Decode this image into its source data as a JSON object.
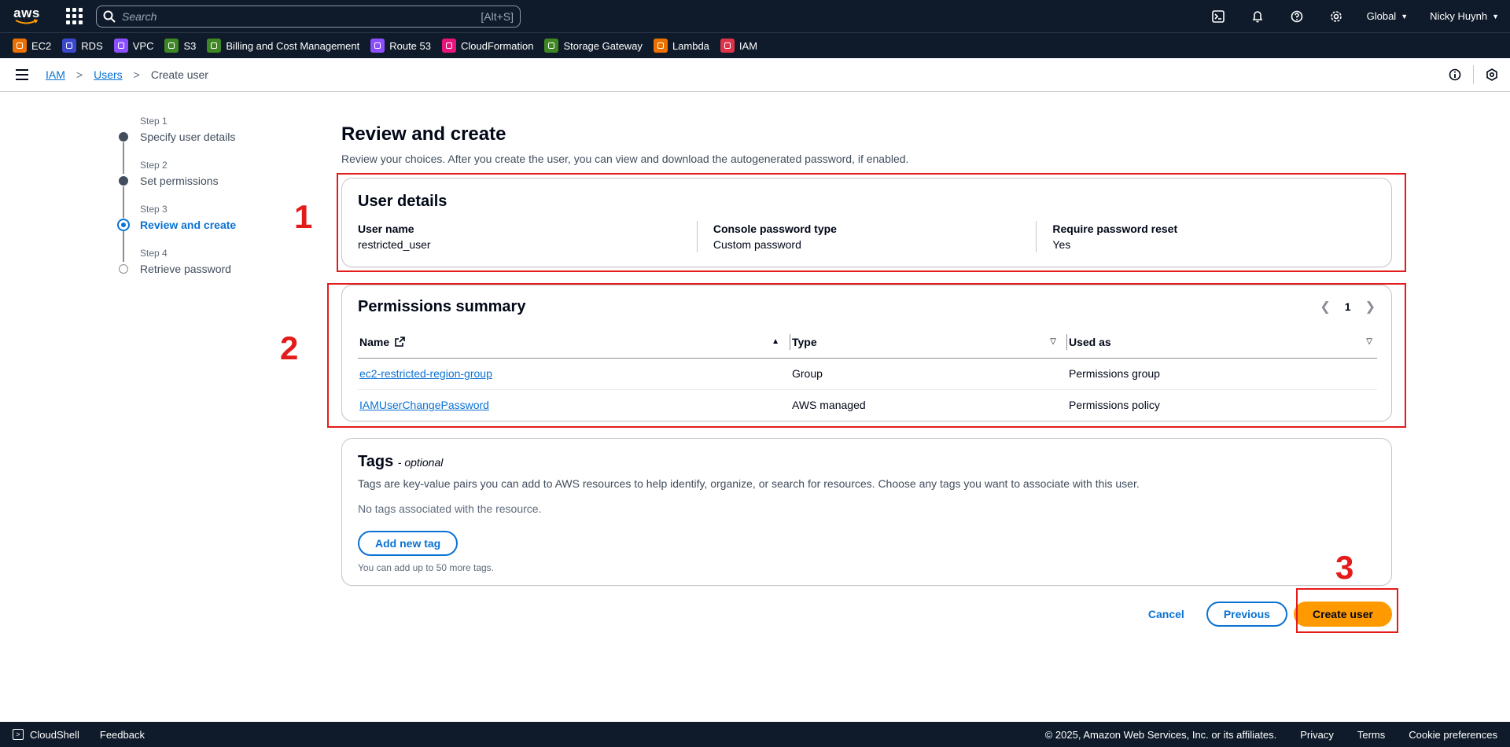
{
  "topbar": {
    "logo_text": "aws",
    "search_placeholder": "Search",
    "search_hint": "[Alt+S]",
    "region": "Global",
    "user": "Nicky Huynh"
  },
  "favorites": [
    {
      "label": "EC2",
      "color": "#ed7100"
    },
    {
      "label": "RDS",
      "color": "#3b48cc"
    },
    {
      "label": "VPC",
      "color": "#8c4fff"
    },
    {
      "label": "S3",
      "color": "#3f8624"
    },
    {
      "label": "Billing and Cost Management",
      "color": "#3f8624"
    },
    {
      "label": "Route 53",
      "color": "#8c4fff"
    },
    {
      "label": "CloudFormation",
      "color": "#e7157b"
    },
    {
      "label": "Storage Gateway",
      "color": "#3f8624"
    },
    {
      "label": "Lambda",
      "color": "#ed7100"
    },
    {
      "label": "IAM",
      "color": "#dd344c"
    }
  ],
  "breadcrumb": {
    "items": [
      "IAM",
      "Users"
    ],
    "current": "Create user"
  },
  "steps": [
    {
      "num": "Step 1",
      "label": "Specify user details",
      "state": "done"
    },
    {
      "num": "Step 2",
      "label": "Set permissions",
      "state": "done"
    },
    {
      "num": "Step 3",
      "label": "Review and create",
      "state": "active"
    },
    {
      "num": "Step 4",
      "label": "Retrieve password",
      "state": "future"
    }
  ],
  "main": {
    "title": "Review and create",
    "description": "Review your choices. After you create the user, you can view and download the autogenerated password, if enabled."
  },
  "user_details": {
    "title": "User details",
    "fields": [
      {
        "key": "User name",
        "value": "restricted_user"
      },
      {
        "key": "Console password type",
        "value": "Custom password"
      },
      {
        "key": "Require password reset",
        "value": "Yes"
      }
    ]
  },
  "permissions": {
    "title": "Permissions summary",
    "page": "1",
    "columns": [
      "Name",
      "Type",
      "Used as"
    ],
    "rows": [
      {
        "name": "ec2-restricted-region-group",
        "type": "Group",
        "used_as": "Permissions group"
      },
      {
        "name": "IAMUserChangePassword",
        "type": "AWS managed",
        "used_as": "Permissions policy"
      }
    ]
  },
  "tags": {
    "title": "Tags",
    "optional": "- optional",
    "description": "Tags are key-value pairs you can add to AWS resources to help identify, organize, or search for resources. Choose any tags you want to associate with this user.",
    "empty": "No tags associated with the resource.",
    "add_button": "Add new tag",
    "limit": "You can add up to 50 more tags."
  },
  "actions": {
    "cancel": "Cancel",
    "previous": "Previous",
    "create": "Create user"
  },
  "annotations": [
    "1",
    "2",
    "3"
  ],
  "footer": {
    "cloudshell": "CloudShell",
    "feedback": "Feedback",
    "copyright": "© 2025, Amazon Web Services, Inc. or its affiliates.",
    "privacy": "Privacy",
    "terms": "Terms",
    "cookies": "Cookie preferences"
  }
}
